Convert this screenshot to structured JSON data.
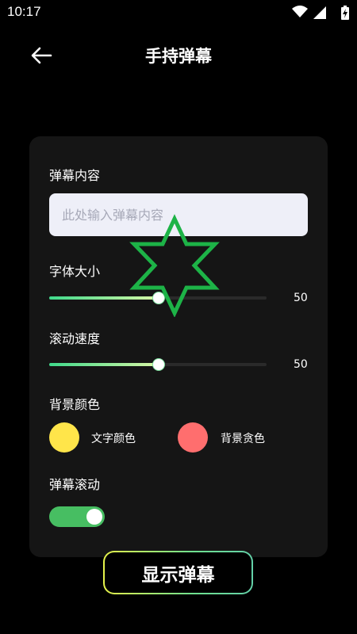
{
  "status_bar": {
    "time": "10:17",
    "icons": [
      "wifi-icon",
      "signal-icon",
      "battery-charging-icon"
    ]
  },
  "header": {
    "title": "手持弹幕",
    "back_icon": "arrow-left-icon"
  },
  "form": {
    "content_label": "弹幕内容",
    "content_placeholder": "此处输入弹幕内容",
    "content_value": "",
    "font_size": {
      "label": "字体大小",
      "value": 50,
      "display": "50",
      "min": 0,
      "max": 100
    },
    "scroll_speed": {
      "label": "滚动速度",
      "value": 50,
      "display": "50",
      "min": 0,
      "max": 100
    },
    "background": {
      "label": "背景颜色",
      "text_color": {
        "label": "文字颜色",
        "color": "#ffe54a"
      },
      "bg_color": {
        "label": "背景贪色",
        "color": "#ff6e6e"
      }
    },
    "scroll_toggle": {
      "label": "弹幕滚动",
      "on": true
    }
  },
  "display_button": {
    "label": "显示弹幕"
  },
  "colors": {
    "accent_green": "#47be62",
    "slider_gradient_start": "#3fd98b",
    "slider_gradient_end": "#d8f8a6",
    "card_bg": "#151515",
    "star_green": "#1db347"
  }
}
